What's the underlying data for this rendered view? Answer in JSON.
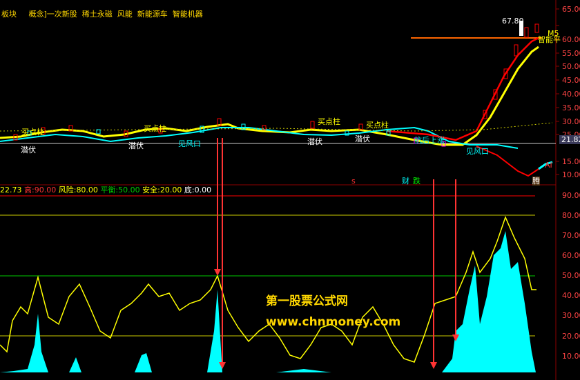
{
  "header": {
    "items": [
      "板块",
      "概念]一次新股",
      "稀土永磁",
      "风能",
      "新能源车",
      "智能机器"
    ]
  },
  "price_axis": {
    "ticks": [
      "65.00",
      "60.00",
      "55.00",
      "50.00",
      "45.00",
      "40.00",
      "35.00",
      "30.00",
      "25.00",
      "21.82",
      "15.00",
      "10.00"
    ],
    "current_label": "21.82",
    "ai_label": "AI"
  },
  "indicator_axis": {
    "ticks": [
      "90.00",
      "80.00",
      "70.00",
      "60.00",
      "50.00",
      "40.00",
      "30.00",
      "20.00",
      "10.00"
    ]
  },
  "indicator_header": {
    "value": "22.73",
    "gao_label": "高:",
    "gao_value": "90.00",
    "risk_label": "风险:",
    "risk_value": "80.00",
    "balance_label": "平衡:",
    "balance_value": "50.00",
    "safe_label": "安全:",
    "safe_value": "20.00",
    "bottom_label": "底:",
    "bottom_value": "0.00"
  },
  "annotations": {
    "peak_price": "67.80",
    "ma_label": "M5",
    "zhineng": "智能平",
    "buy_points": [
      "买点柱",
      "买点柱",
      "买点柱",
      "买点柱"
    ],
    "dragon": [
      "潜伏",
      "潜伏",
      "潜伏",
      "潜伏"
    ],
    "wind": [
      "见风口",
      "见风口"
    ],
    "anti_rise": "抗后上涨",
    "caili": "财",
    "die": "跌",
    "teng": "腾",
    "s_marker": "s"
  },
  "watermark": {
    "line1": "第一股票公式网",
    "line2": "www.chnmoney.com"
  },
  "colors": {
    "bg": "#000000",
    "yellow": "#ffff00",
    "cyan": "#00ffff",
    "red": "#ff0000",
    "green": "#00cc00",
    "orange": "#ff8800",
    "magenta": "#ff00ff",
    "blue": "#3333ff"
  }
}
